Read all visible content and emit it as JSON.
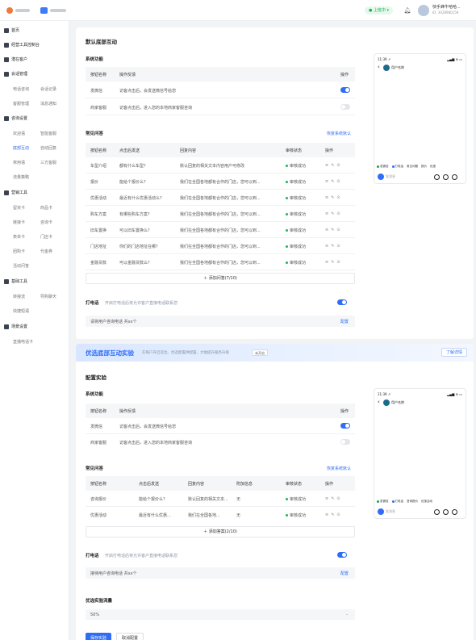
{
  "header": {
    "online_status": "● 上班中 ▾",
    "user_name": "快手蜂牛哈哈...",
    "user_id": "ID: 3028980159"
  },
  "sidebar": {
    "groups": [
      {
        "label": "首页",
        "icon": "home-icon"
      },
      {
        "label": "经营工具控制台",
        "icon": "console-icon"
      },
      {
        "label": "潜在客户",
        "icon": "customer-icon"
      },
      {
        "label": "会话管理",
        "icon": "chat-icon"
      },
      {
        "label": "咨询设置",
        "icon": "settings-icon"
      },
      {
        "label": "营销工具",
        "icon": "marketing-icon"
      },
      {
        "label": "基础工具",
        "icon": "tools-icon"
      },
      {
        "label": "场景设置",
        "icon": "scene-icon"
      }
    ],
    "subs": {
      "session": [
        "电话咨询",
        "会话记录",
        "客服管理",
        "消息通知"
      ],
      "consult": [
        "欢迎语",
        "智能客服",
        "底部互动",
        "自动回复",
        "常用语",
        "三方客服",
        "流量策略"
      ],
      "marketing": [
        "留资卡",
        "商品卡",
        "链接卡",
        "咨询卡",
        "表单卡",
        "门店卡",
        "团购卡",
        "代金券",
        "活动问答"
      ],
      "basic": [
        "转接流",
        "导购聊天",
        "快捷短语"
      ],
      "scene": [
        "直播电话卡"
      ]
    }
  },
  "section1": {
    "title": "默认底部互动",
    "system_functions_title": "系统功能",
    "sys_headers": [
      "按钮名称",
      "操作反馈",
      "操作"
    ],
    "sys_rows": [
      {
        "name": "发微信",
        "feedback": "访客点击后，会发送微信号给您",
        "enabled": true
      },
      {
        "name": "商家客服",
        "feedback": "访客点击后，进入您的本地商家客服咨询",
        "enabled": false
      }
    ],
    "faq_title": "常见问答",
    "restore_link": "恢复系统默认",
    "faq_headers": [
      "按钮名称",
      "点击后发送",
      "回复内容",
      "审核状态",
      "操作"
    ],
    "faq_rows": [
      {
        "name": "车型介绍",
        "send": "都有什么车型？",
        "reply": "默认回复的相关文本内容用户可修改",
        "status": "审核成功"
      },
      {
        "name": "报价",
        "send": "能给个报价么？",
        "reply": "我们在全国各地都有合作的门店，您可以到...",
        "status": "审核成功"
      },
      {
        "name": "优惠活动",
        "send": "最近有什么优惠活动么？",
        "reply": "我们在全国各地都有合作的门店，您可以到...",
        "status": "审核成功"
      },
      {
        "name": "购车方案",
        "send": "有哪些购车方案？",
        "reply": "我们在全国各地都有合作的门店，您可以到...",
        "status": "审核成功"
      },
      {
        "name": "旧车置换",
        "send": "可以旧车置换么？",
        "reply": "我们在全国各地都有合作的门店，您可以到...",
        "status": "审核成功"
      },
      {
        "name": "门店地址",
        "send": "你们的门店地址在哪？",
        "reply": "我们在全国各地都有合作的门店，您可以到...",
        "status": "审核成功"
      },
      {
        "name": "金融贷款",
        "send": "可以金融贷款么？",
        "reply": "我们在全国各地都有合作的门店，您可以到...",
        "status": "审核成功"
      }
    ],
    "add_label": "＋ 添加问答(7/10)",
    "call_title": "打电话",
    "call_desc": "开启打电话后将允许客户直接电话联系您",
    "call_field": "请将用户咨询电话 共xx个",
    "config_link": "配置"
  },
  "phone1": {
    "time": "11:39 ↗",
    "signal": "▂▄▆ ≋ ▭",
    "name": "用户名称",
    "chips": [
      "发微信",
      "打电话",
      "常见问题",
      "报价",
      "优惠"
    ],
    "input_placeholder": "发消息"
  },
  "banner": {
    "title": "优选底部互动实验",
    "desc": "在每户开启首位、优选配置供配置、大幅提升服务升级",
    "tag": "未开启",
    "button": "了解详情"
  },
  "section2": {
    "title": "配置实验",
    "system_functions_title": "系统功能",
    "sys_headers": [
      "按钮名称",
      "操作反馈",
      "操作"
    ],
    "sys_rows": [
      {
        "name": "发微信",
        "feedback": "访客点击后，会发送微信号给您",
        "enabled": true
      },
      {
        "name": "商家客服",
        "feedback": "访客点击后，进入您的本地商家客服咨询",
        "enabled": false
      }
    ],
    "faq_title": "常见问答",
    "restore_link": "恢复系统默认",
    "faq_headers": [
      "按钮名称",
      "点击后发送",
      "回复内容",
      "附加信息",
      "审核状态",
      "操作"
    ],
    "faq_rows": [
      {
        "name": "咨询报价",
        "send": "能给个报价么？",
        "reply": "默认回复的相关文本...",
        "extra": "无",
        "status": "审核成功"
      },
      {
        "name": "优惠活动",
        "send": "最近有什么优惠...",
        "reply": "我们在全国各地...",
        "extra": "无",
        "status": "审核成功"
      }
    ],
    "add_label": "＋ 添加答案(2/10)",
    "call_title": "打电话",
    "call_desc": "开启打电话后将允许客户直接电话联系您",
    "call_field": "接待用户咨询电话 共xx个",
    "config_link": "配置",
    "traffic_title": "优选实验流量",
    "traffic_value": "50%",
    "save_button": "保存实验",
    "cancel_button": "取消配置"
  },
  "phone2": {
    "time": "11:39 ↗",
    "signal": "▂▄▆ ≋ ▭",
    "name": "用户名称",
    "chips": [
      "发微信",
      "打电话",
      "咨询报价",
      "优惠活动"
    ],
    "input_placeholder": "发消息"
  }
}
